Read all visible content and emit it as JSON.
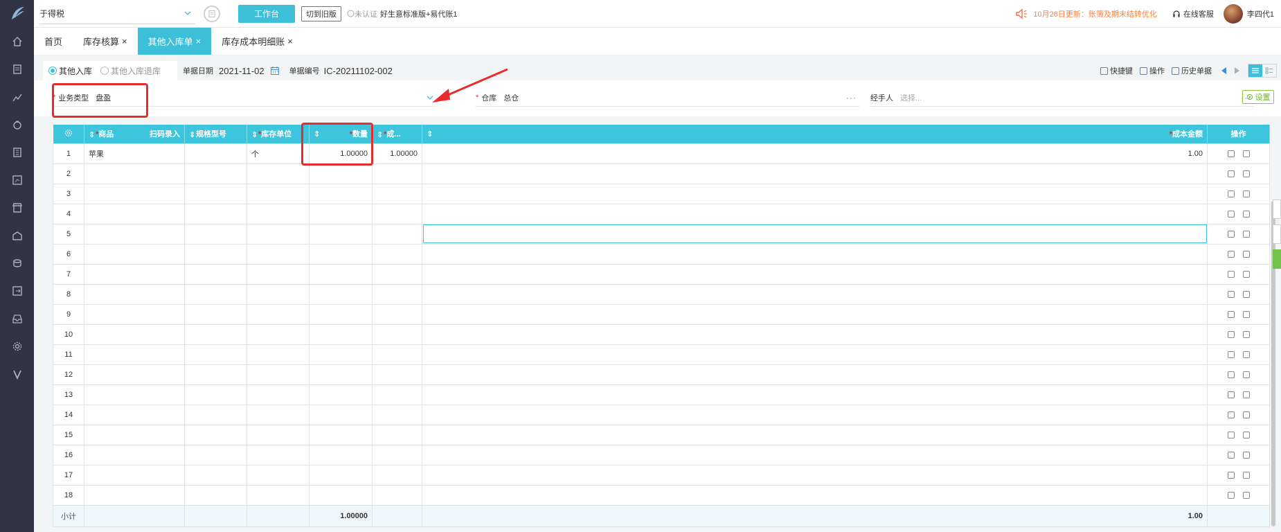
{
  "topbar": {
    "company": "于得税",
    "workbench_label": "工作台",
    "old_version_label": "切到旧版",
    "verify_status": "未认证",
    "plan_name": "好生意标准版+易代账1",
    "notice": "10月26日更新：账簿及期末结转优化",
    "service_label": "在线客服",
    "username": "李四代1"
  },
  "tabs": [
    {
      "label": "首页",
      "closable": false
    },
    {
      "label": "库存核算",
      "closable": true
    },
    {
      "label": "其他入库单",
      "closable": true,
      "active": true
    },
    {
      "label": "库存成本明细账",
      "closable": true
    }
  ],
  "close_glyph": "×",
  "doc": {
    "radio_in": "其他入库",
    "radio_return": "其他入库退库",
    "date_label": "单据日期",
    "date_value": "2021-11-02",
    "docno_label": "单据编号",
    "docno_value": "IC-20211102-002",
    "tools": [
      "快捷键",
      "操作",
      "历史单据"
    ]
  },
  "form": {
    "biz_type_label": "业务类型",
    "biz_type_value": "盘盈",
    "warehouse_label": "仓库",
    "warehouse_value": "总仓",
    "handler_label": "经手人",
    "handler_placeholder": "选择...",
    "settings_label": "设置",
    "required_mark": "*"
  },
  "table": {
    "headers": {
      "product": "商品",
      "scan": "扫码录入",
      "spec": "规格型号",
      "unit": "库存单位",
      "qty": "数量",
      "cost": "成...",
      "amount": "成本金额",
      "ops": "操作"
    },
    "rows": [
      {
        "no": "1",
        "product": "苹果",
        "spec": "",
        "unit": "个",
        "qty": "1.00000",
        "cost": "1.00000",
        "amount": "1.00"
      },
      {
        "no": "2"
      },
      {
        "no": "3"
      },
      {
        "no": "4"
      },
      {
        "no": "5"
      },
      {
        "no": "6"
      },
      {
        "no": "7"
      },
      {
        "no": "8"
      },
      {
        "no": "9"
      },
      {
        "no": "10"
      },
      {
        "no": "11"
      },
      {
        "no": "12"
      },
      {
        "no": "13"
      },
      {
        "no": "14"
      },
      {
        "no": "15"
      },
      {
        "no": "16"
      },
      {
        "no": "17"
      },
      {
        "no": "18"
      }
    ],
    "subtotal_label": "小计",
    "subtotal_qty": "1.00000",
    "subtotal_amount": "1.00"
  },
  "colors": {
    "accent": "#3cbfd8",
    "sidebar": "#2f3544",
    "annotation": "#e62c2c"
  }
}
